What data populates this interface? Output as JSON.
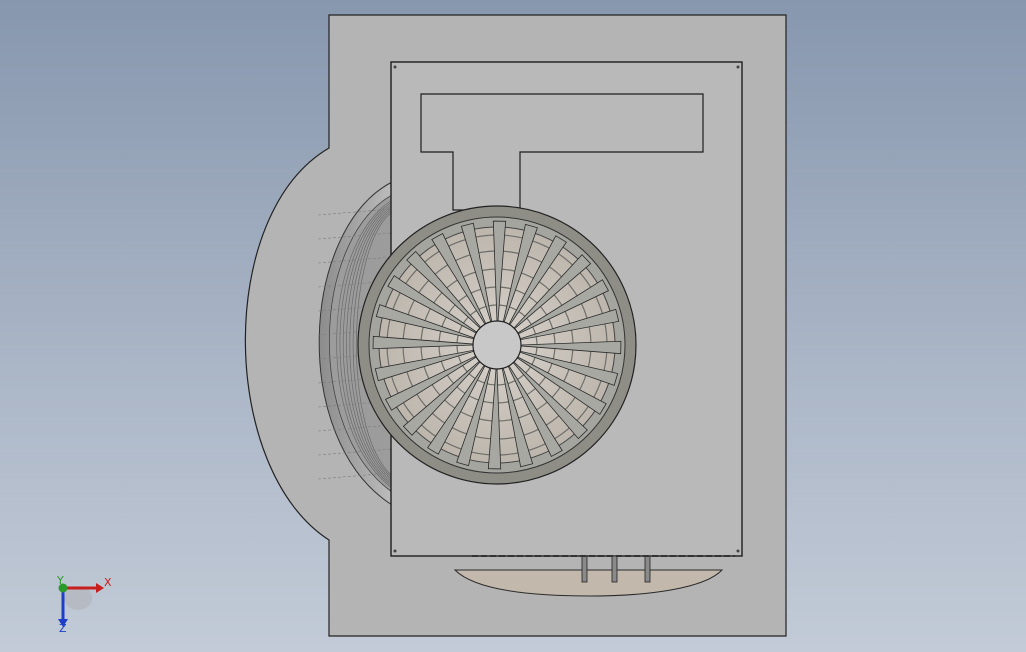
{
  "triad": {
    "x_label": "X",
    "y_label": "Y",
    "z_label": "Z",
    "x_color": "#c81e1e",
    "y_color": "#2a9a2a",
    "z_color": "#1e3ec8"
  },
  "model": {
    "housing_color": "#b4b4b4",
    "panel_color": "#b9b9b9",
    "fan_ring_color": "#8a8a82",
    "blade_color": "#a8a8a3",
    "inner_color": "#c9c3bb",
    "outline_color": "#1e1e1e",
    "fan_spoke_count": 24
  }
}
